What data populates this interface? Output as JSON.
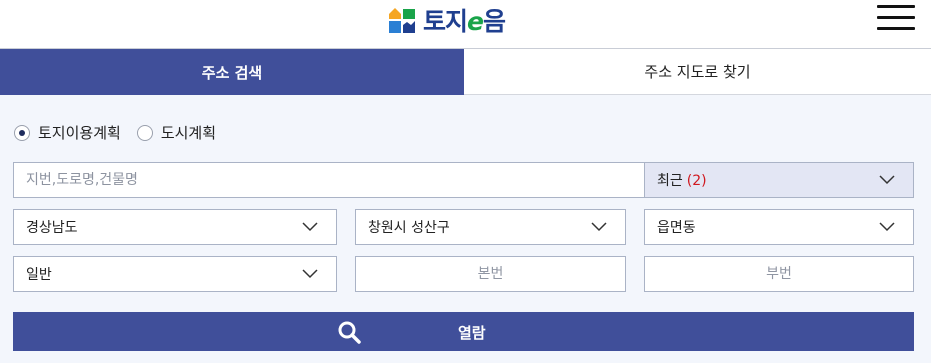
{
  "header": {
    "logo_text_main": "토지",
    "logo_text_e": "e",
    "logo_text_end": "음"
  },
  "tabs": [
    {
      "label": "주소 검색",
      "active": true
    },
    {
      "label": "주소 지도로 찾기",
      "active": false
    }
  ],
  "radios": [
    {
      "label": "토지이용계획",
      "checked": true
    },
    {
      "label": "도시계획",
      "checked": false
    }
  ],
  "search": {
    "placeholder": "지번,도로명,건물명",
    "value": ""
  },
  "recent": {
    "label": "최근",
    "count": "(2)"
  },
  "selects": {
    "sido": "경상남도",
    "sigungu": "창원시 성산구",
    "dong": "읍면동",
    "type": "일반"
  },
  "inputs": {
    "bonbun_placeholder": "본번",
    "bubun_placeholder": "부번"
  },
  "view_button": {
    "label": "열람"
  },
  "colors": {
    "primary": "#404f9a",
    "recent_bg": "#e3e6f4",
    "count_red": "#d0181f",
    "page_bg": "#f3f6fc"
  }
}
